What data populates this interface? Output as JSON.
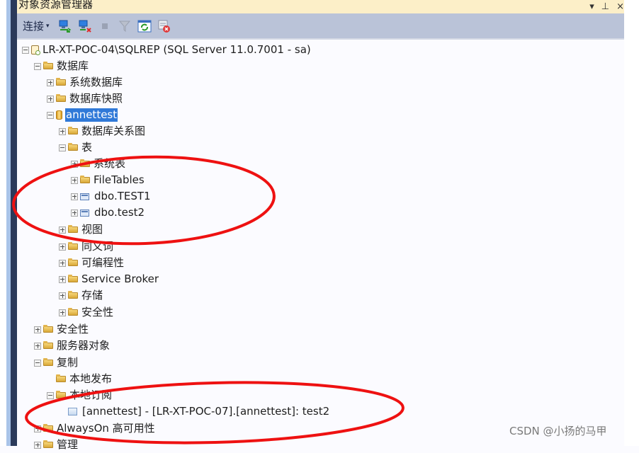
{
  "window": {
    "title": "对象资源管理器",
    "controls": {
      "dropdown": "▾",
      "pin": "⊥",
      "close": "×"
    }
  },
  "toolbar": {
    "connect_label": "连接",
    "connect_caret": "▾",
    "icons": [
      {
        "name": "connect-object-explorer-icon"
      },
      {
        "name": "disconnect-icon"
      },
      {
        "name": "stop-icon"
      },
      {
        "name": "filter-icon"
      },
      {
        "name": "refresh-icon"
      },
      {
        "name": "summary-close-icon"
      }
    ]
  },
  "tree": {
    "server": {
      "label": "LR-XT-POC-04\\SQLREP (SQL Server 11.0.7001 - sa)",
      "state": "expanded"
    },
    "databases": {
      "label": "数据库",
      "state": "expanded"
    },
    "system_databases": {
      "label": "系统数据库",
      "state": "collapsed"
    },
    "db_snapshots": {
      "label": "数据库快照",
      "state": "collapsed"
    },
    "annettest": {
      "label": "annettest",
      "state": "expanded",
      "selected": true
    },
    "db_diagrams": {
      "label": "数据库关系图",
      "state": "collapsed"
    },
    "tables": {
      "label": "表",
      "state": "expanded"
    },
    "system_tables": {
      "label": "系统表",
      "state": "collapsed"
    },
    "filetables": {
      "label": "FileTables",
      "state": "collapsed"
    },
    "dbo_test1": {
      "label": "dbo.TEST1",
      "state": "collapsed"
    },
    "dbo_test2": {
      "label": "dbo.test2",
      "state": "collapsed"
    },
    "views": {
      "label": "视图",
      "state": "collapsed"
    },
    "synonyms": {
      "label": "同义词",
      "state": "collapsed"
    },
    "programmability": {
      "label": "可编程性",
      "state": "collapsed"
    },
    "service_broker": {
      "label": "Service Broker",
      "state": "collapsed"
    },
    "storage": {
      "label": "存储",
      "state": "collapsed"
    },
    "db_security": {
      "label": "安全性",
      "state": "collapsed"
    },
    "security": {
      "label": "安全性",
      "state": "collapsed"
    },
    "server_objects": {
      "label": "服务器对象",
      "state": "collapsed"
    },
    "replication": {
      "label": "复制",
      "state": "expanded"
    },
    "local_publications": {
      "label": "本地发布",
      "state": "leaf"
    },
    "local_subscriptions": {
      "label": "本地订阅",
      "state": "expanded"
    },
    "subscription_item": {
      "label": "[annettest] - [LR-XT-POC-07].[annettest]: test2",
      "state": "leaf"
    },
    "alwayson": {
      "label": "AlwaysOn 高可用性",
      "state": "collapsed"
    },
    "management": {
      "label": "管理",
      "state": "collapsed"
    }
  },
  "annotations": {
    "color": "#ee1111",
    "ellipses": [
      {
        "name": "tables-highlight-ellipse",
        "encloses": [
          "系统表",
          "FileTables",
          "dbo.TEST1",
          "dbo.test2"
        ]
      },
      {
        "name": "subscription-highlight-ellipse",
        "encloses": [
          "本地订阅",
          "[annettest] - [LR-XT-POC-07].[annettest]: test2"
        ]
      }
    ]
  },
  "watermark": "CSDN @小扬的马甲",
  "colors": {
    "title_bg": "#fcefc8",
    "toolbar_bg": "#bac3d8",
    "selection": "#3079d8",
    "tree_bg": "#fbfbff"
  }
}
